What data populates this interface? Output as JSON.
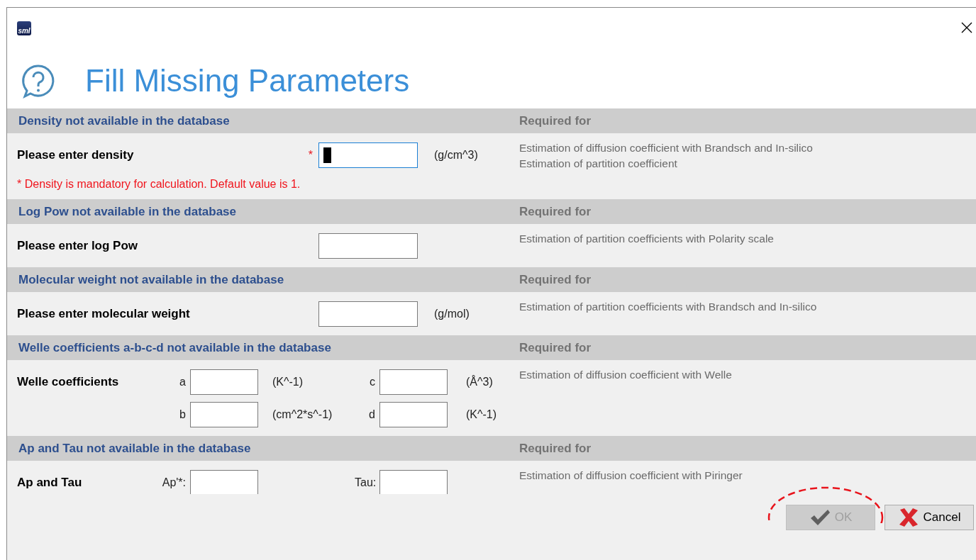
{
  "window": {
    "logo_text": "sml",
    "title": "Fill Missing Parameters"
  },
  "sections": [
    {
      "kind": "single",
      "heading": "Density not available in the database",
      "required_heading": "Required for",
      "label": "Please enter density",
      "fields": [
        {
          "prefix": "*",
          "required": true,
          "unit": "(g/cm^3)",
          "focused": true
        }
      ],
      "note": "* Density is mandatory for calculation. Default value is 1.",
      "required_for": [
        "Estimation of diffusion coefficient with Brandsch and In-silico",
        "Estimation of partition coefficient"
      ]
    },
    {
      "kind": "single",
      "heading": "Log Pow not available in the database",
      "required_heading": "Required for",
      "label": "Please enter log Pow",
      "fields": [
        {
          "focused": false
        }
      ],
      "required_for": [
        "Estimation of partition coefficients with Polarity scale"
      ]
    },
    {
      "kind": "single",
      "heading": "Molecular weight not available in the database",
      "required_heading": "Required for",
      "label": "Please enter molecular weight",
      "fields": [
        {
          "unit": "(g/mol)",
          "focused": false
        }
      ],
      "required_for": [
        "Estimation of partition coefficients with Brandsch and In-silico"
      ]
    },
    {
      "kind": "multi",
      "heading": "Welle coefficients a-b-c-d not available in the database",
      "required_heading": "Required for",
      "label": "Welle coefficients",
      "fields": [
        {
          "prefix": "a",
          "required": false,
          "unit": "(K^-1)",
          "focused": false
        },
        {
          "prefix": "c",
          "required": false,
          "unit": "(Å^3)",
          "focused": false
        },
        {
          "prefix": "b",
          "required": false,
          "unit": "(cm^2*s^-1)",
          "focused": false
        },
        {
          "prefix": "d",
          "required": false,
          "unit": "(K^-1)",
          "focused": false
        }
      ],
      "required_for": [
        "Estimation of diffusion coefficient with Welle"
      ]
    },
    {
      "kind": "multi",
      "heading": "Ap and Tau not available in the database",
      "required_heading": "Required for",
      "label": "Ap and Tau",
      "fields": [
        {
          "prefix": "Ap'*:",
          "required": false,
          "focused": false
        },
        {
          "prefix": "Tau:",
          "required": false,
          "focused": false
        }
      ],
      "required_for": [
        "Estimation of diffusion coefficient with Piringer"
      ]
    }
  ],
  "buttons": [
    {
      "kind": "ok",
      "label": "OK",
      "disabled": true,
      "highlighted": true
    },
    {
      "kind": "cancel",
      "label": "Cancel",
      "disabled": false,
      "highlighted": false
    }
  ]
}
